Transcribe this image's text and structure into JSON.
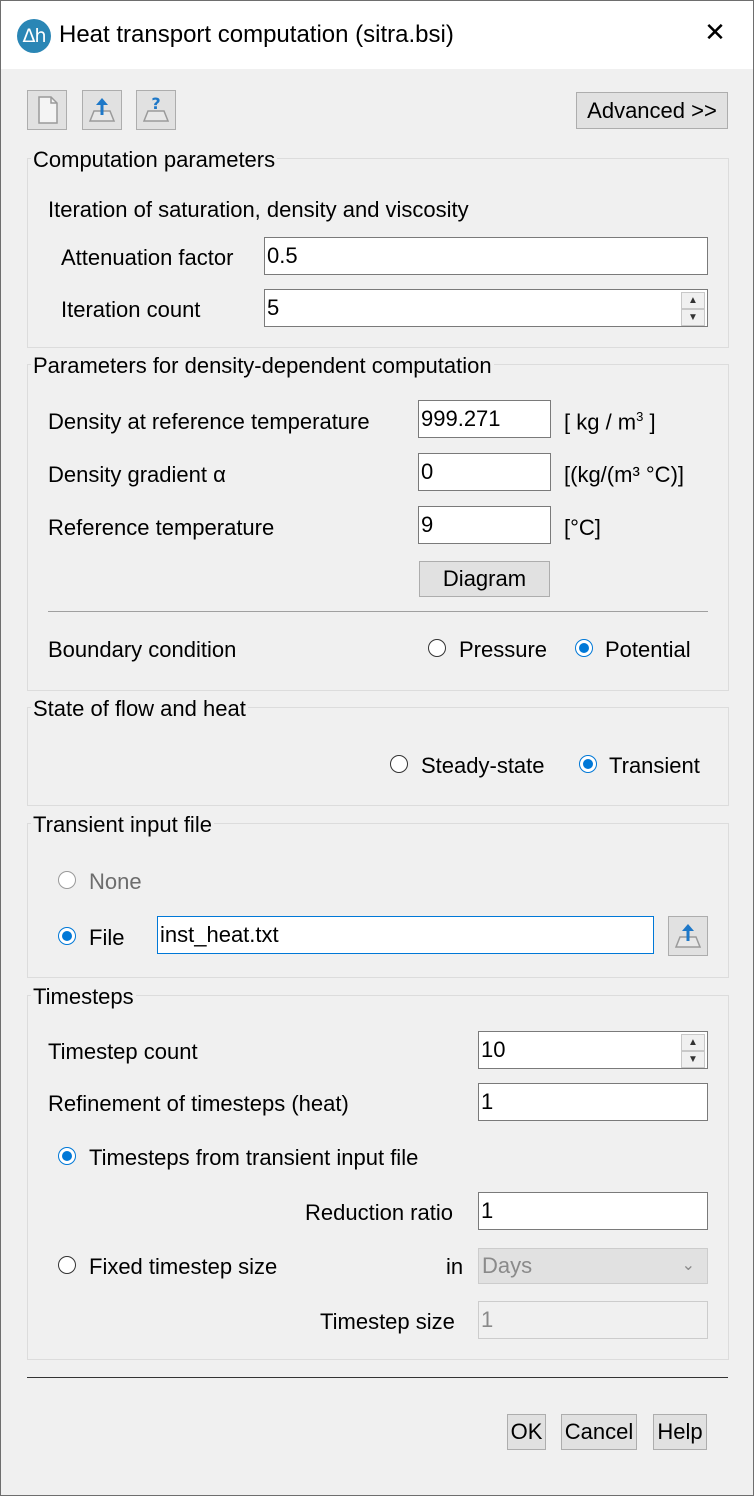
{
  "window": {
    "app_icon_text": "Δh",
    "title": "Heat transport computation (sitra.bsi)"
  },
  "toolbar": {
    "advanced_label": "Advanced >>"
  },
  "computation": {
    "group_title": "Computation parameters",
    "subtitle": "Iteration of saturation, density and viscosity",
    "attenuation_label": "Attenuation factor",
    "attenuation_value": "0.5",
    "iteration_label": "Iteration count",
    "iteration_value": "5"
  },
  "density": {
    "group_title": "Parameters for density-dependent computation",
    "ref_density_label": "Density at reference temperature",
    "ref_density_value": "999.271",
    "ref_density_unit_main": "[ kg / m",
    "ref_density_unit_sup": "3",
    "ref_density_unit_end": " ]",
    "gradient_label": "Density gradient α",
    "gradient_value": "0",
    "gradient_unit": "[(kg/(m³ °C)]",
    "ref_temp_label": "Reference temperature",
    "ref_temp_value": "9",
    "ref_temp_unit": "[°C]",
    "diagram_label": "Diagram",
    "boundary_label": "Boundary condition",
    "pressure_label": "Pressure",
    "potential_label": "Potential",
    "boundary_selected": "Potential"
  },
  "state": {
    "group_title": "State of flow and heat",
    "steady_label": "Steady-state",
    "transient_label": "Transient",
    "selected": "Transient"
  },
  "transient_file": {
    "group_title": "Transient input file",
    "none_label": "None",
    "file_label": "File",
    "file_value": "inst_heat.txt",
    "selected": "File"
  },
  "timesteps": {
    "group_title": "Timesteps",
    "count_label": "Timestep count",
    "count_value": "10",
    "refinement_label": "Refinement of timesteps (heat)",
    "refinement_value": "1",
    "from_file_label": "Timesteps from transient input file",
    "reduction_label": "Reduction ratio",
    "reduction_value": "1",
    "fixed_label": "Fixed timestep size",
    "in_label": "in",
    "unit_value": "Days",
    "size_label": "Timestep size",
    "size_value": "1",
    "selected": "Timesteps from transient input file"
  },
  "footer": {
    "ok_label": "OK",
    "cancel_label": "Cancel",
    "help_label": "Help"
  },
  "colors": {
    "accent": "#0078d7",
    "app_icon": "#2a86b5",
    "dialog_bg": "#f0f0f0"
  }
}
